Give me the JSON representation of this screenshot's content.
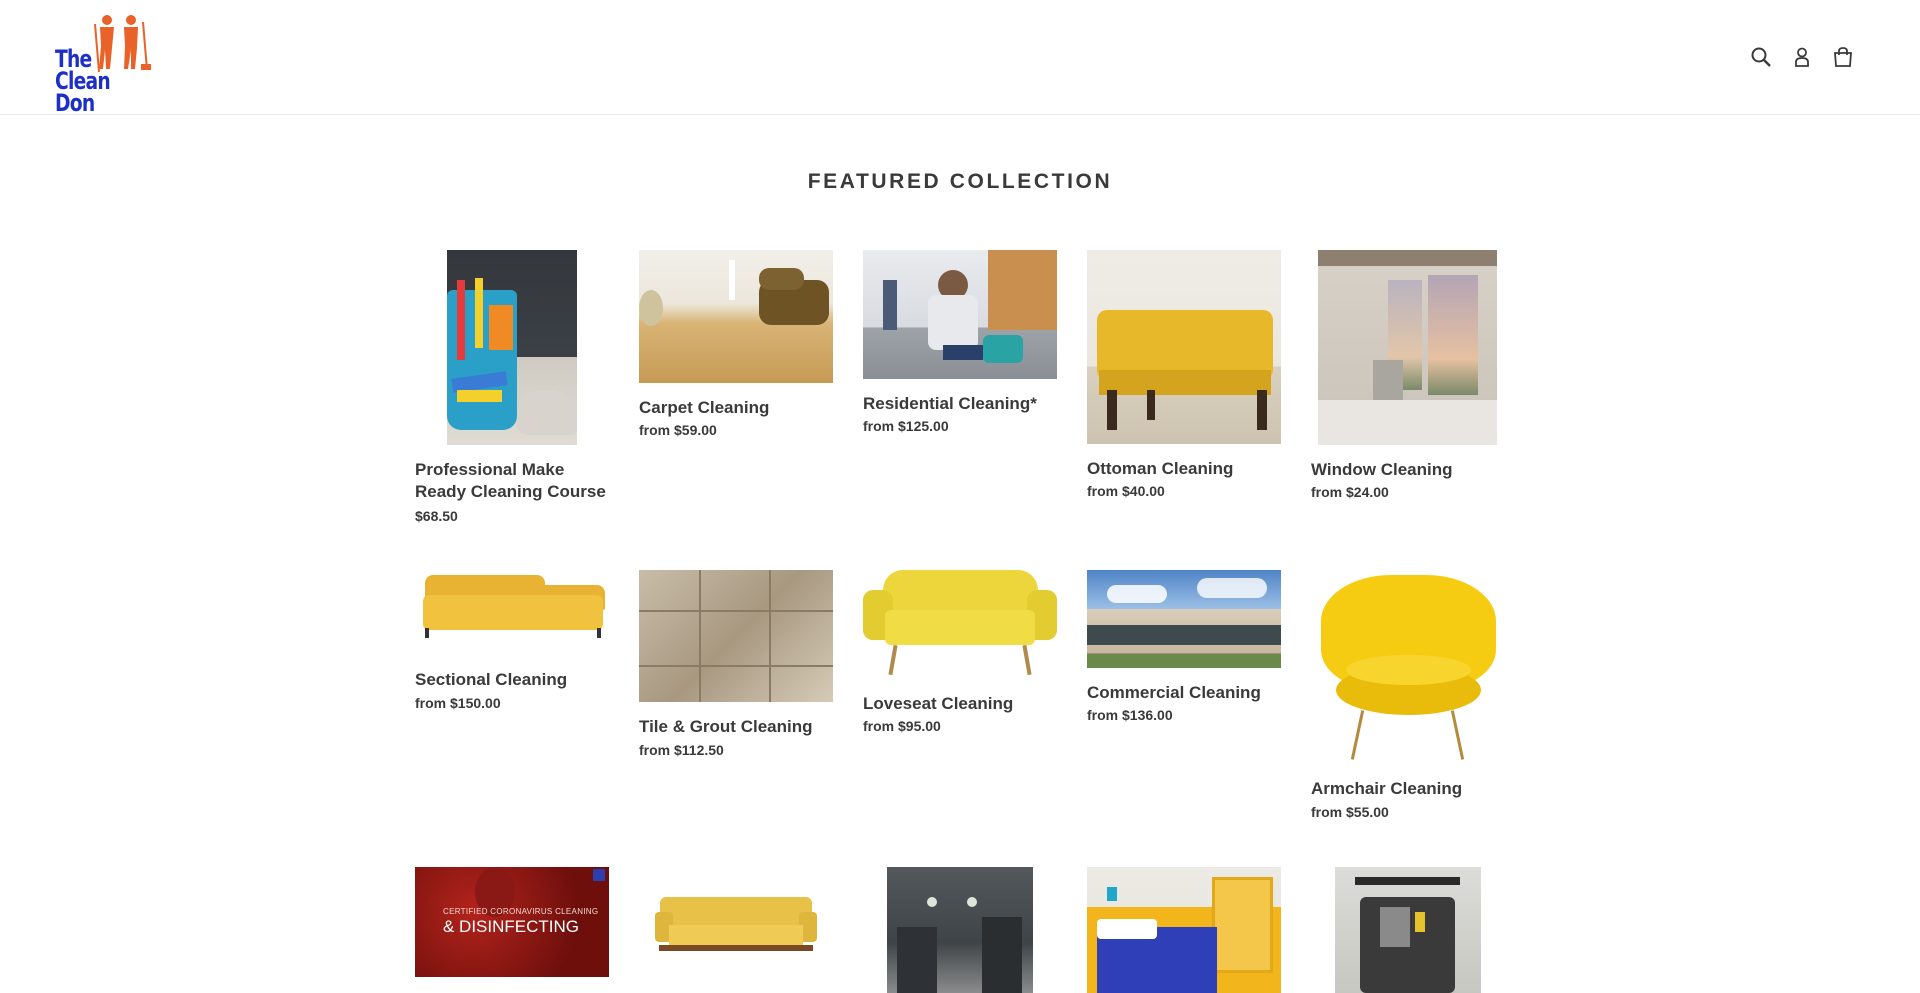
{
  "header": {
    "logo_text": "The Clean Don",
    "icons": [
      "search-icon",
      "account-icon",
      "cart-icon"
    ]
  },
  "collection": {
    "title": "FEATURED COLLECTION",
    "products": [
      {
        "title": "Professional Make Ready Cleaning Course",
        "price": "$68.50"
      },
      {
        "title": "Carpet Cleaning",
        "price": "from $59.00"
      },
      {
        "title": "Residential Cleaning*",
        "price": "from $125.00"
      },
      {
        "title": "Ottoman Cleaning",
        "price": "from $40.00"
      },
      {
        "title": "Window Cleaning",
        "price": "from $24.00"
      },
      {
        "title": "Sectional Cleaning",
        "price": "from $150.00"
      },
      {
        "title": "Tile & Grout Cleaning",
        "price": "from $112.50"
      },
      {
        "title": "Loveseat Cleaning",
        "price": "from $95.00"
      },
      {
        "title": "Commercial Cleaning",
        "price": "from $136.00"
      },
      {
        "title": "Armchair Cleaning",
        "price": "from $55.00"
      },
      {
        "title": "",
        "price": "",
        "image_text": [
          "CERTIFIED CORONAVIRUS CLEANING",
          "& DISINFECTING"
        ]
      },
      {
        "title": "",
        "price": ""
      },
      {
        "title": "",
        "price": ""
      },
      {
        "title": "",
        "price": ""
      },
      {
        "title": "",
        "price": ""
      }
    ]
  },
  "colors": {
    "text": "#3a3a3a",
    "logo_blue": "#1e2fc8",
    "logo_orange": "#e8622a",
    "border": "#e8e9eb"
  }
}
